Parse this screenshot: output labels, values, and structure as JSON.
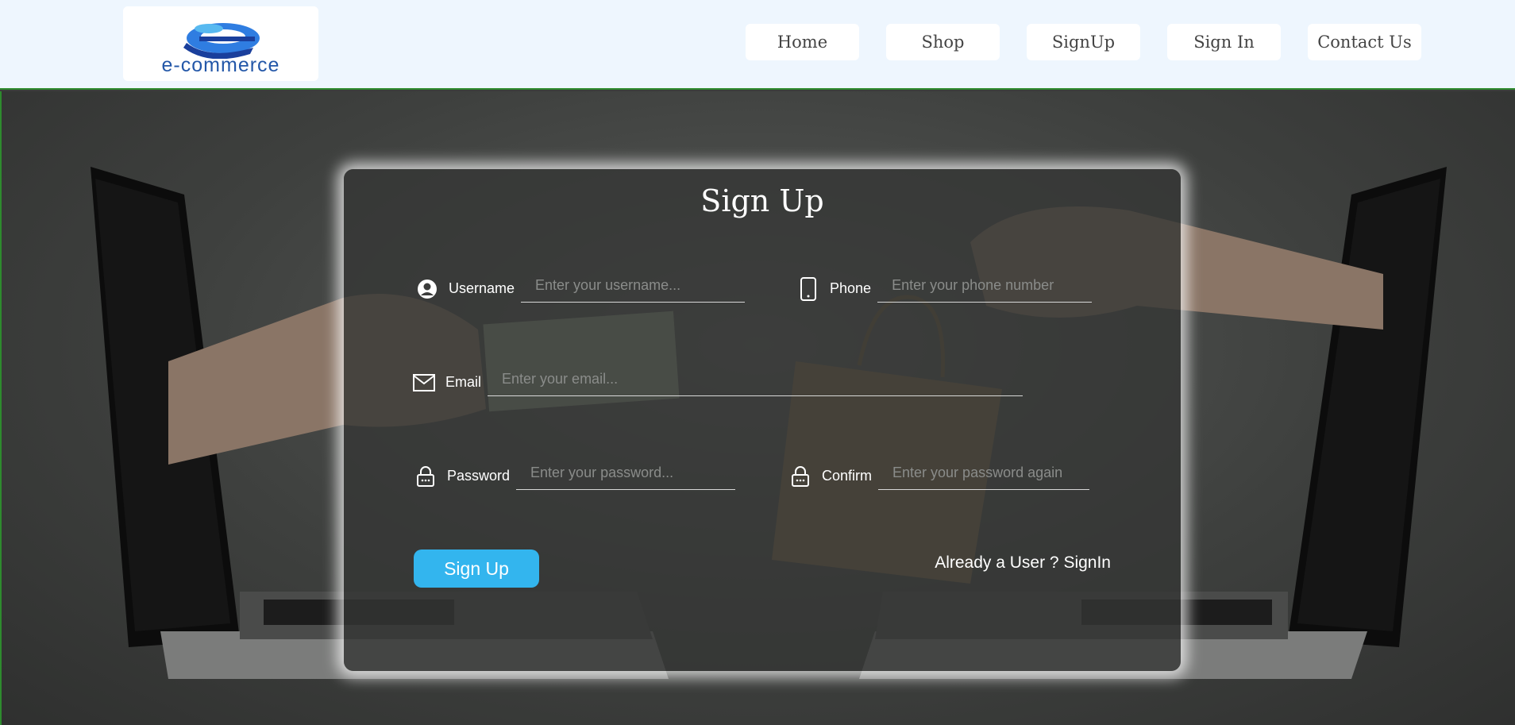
{
  "header": {
    "logo_text": "e-commerce",
    "nav": [
      {
        "label": "Home"
      },
      {
        "label": "Shop"
      },
      {
        "label": "SignUp"
      },
      {
        "label": "Sign In"
      },
      {
        "label": "Contact Us"
      }
    ]
  },
  "form": {
    "title": "Sign Up",
    "username": {
      "label": "Username",
      "placeholder": "Enter your username...",
      "icon": "user-circle-icon"
    },
    "phone": {
      "label": "Phone",
      "placeholder": "Enter your phone number",
      "icon": "phone-icon"
    },
    "email": {
      "label": "Email",
      "placeholder": "Enter your email...",
      "icon": "mail-icon"
    },
    "password": {
      "label": "Password",
      "placeholder": "Enter your password...",
      "icon": "lock-icon"
    },
    "confirm": {
      "label": "Confirm",
      "placeholder": "Enter your password again",
      "icon": "lock-icon"
    },
    "submit_label": "Sign Up",
    "signin_link": "Already a User ? SignIn"
  },
  "colors": {
    "header_bg": "#eef6fe",
    "accent_button": "#33b5ee",
    "brand_blue": "#2357a8",
    "page_bg": "#3b3c3b"
  }
}
